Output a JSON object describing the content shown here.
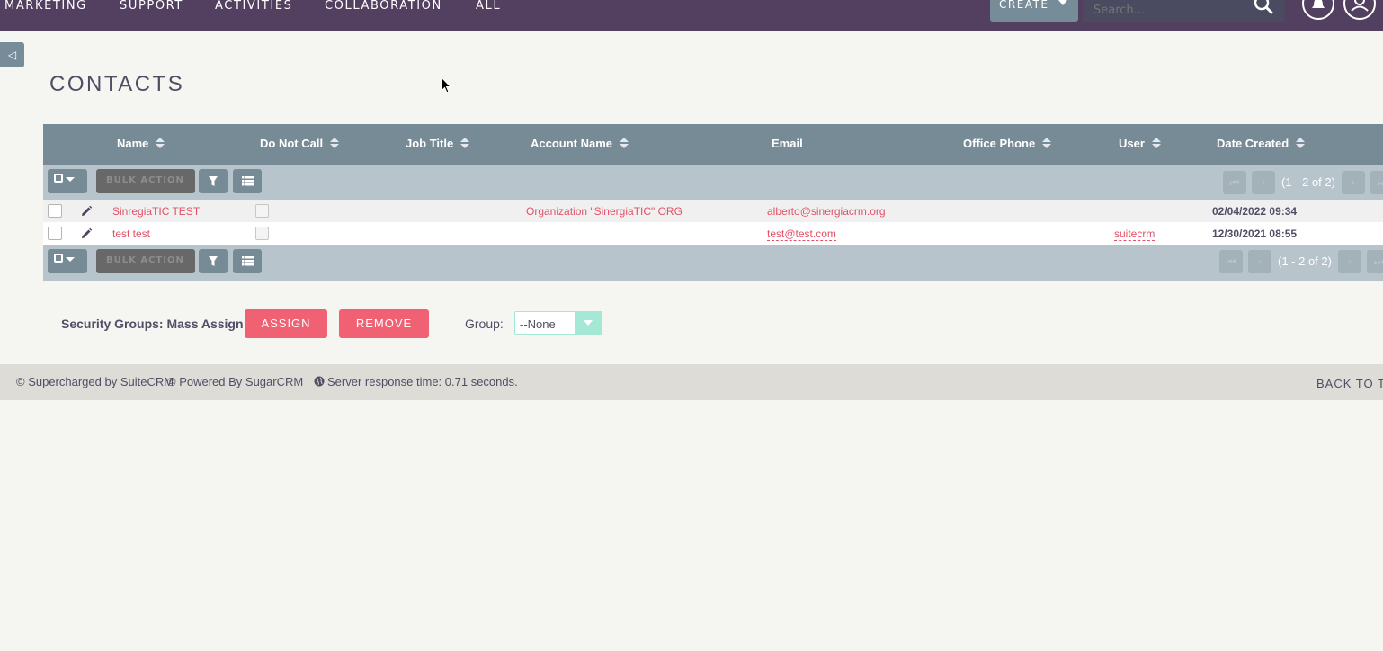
{
  "topnav": {
    "items": [
      "MARKETING",
      "SUPPORT",
      "ACTIVITIES",
      "COLLABORATION",
      "ALL"
    ],
    "create_label": "CREATE",
    "search_placeholder": "Search..."
  },
  "sidebar_toggle": "◁",
  "page": {
    "title": "CONTACTS"
  },
  "list": {
    "columns": [
      "Name",
      "Do Not Call",
      "Job Title",
      "Account Name",
      "Email",
      "Office Phone",
      "User",
      "Date Created"
    ],
    "bulk_action_label": "BULK ACTION",
    "pagination_top": "(1 - 2 of 2)",
    "pagination_bottom": "(1 - 2 of 2)",
    "rows": [
      {
        "name": "SinregiaTIC TEST",
        "account": "Organization \"SinergiaTIC\" ORG",
        "email": "alberto@sinergiacrm.org",
        "user": "",
        "date": "02/04/2022 09:34"
      },
      {
        "name": "test test",
        "account": "",
        "email": "test@test.com",
        "user": "suitecrm",
        "date": "12/30/2021 08:55"
      }
    ]
  },
  "mass_assign": {
    "label": "Security Groups: Mass Assign",
    "assign_label": "ASSIGN",
    "remove_label": "REMOVE",
    "group_label": "Group:",
    "group_value": "--None"
  },
  "footer": {
    "supercharged": "© Supercharged by SuiteCRM",
    "powered": "© Powered By SugarCRM",
    "response": "Server response time: 0.71 seconds.",
    "back_to_top": "BACK TO TO"
  },
  "colors": {
    "nav_bg": "#534060",
    "header_bg": "#778b97",
    "accent_red": "#f06173",
    "link_red": "#e05267"
  }
}
